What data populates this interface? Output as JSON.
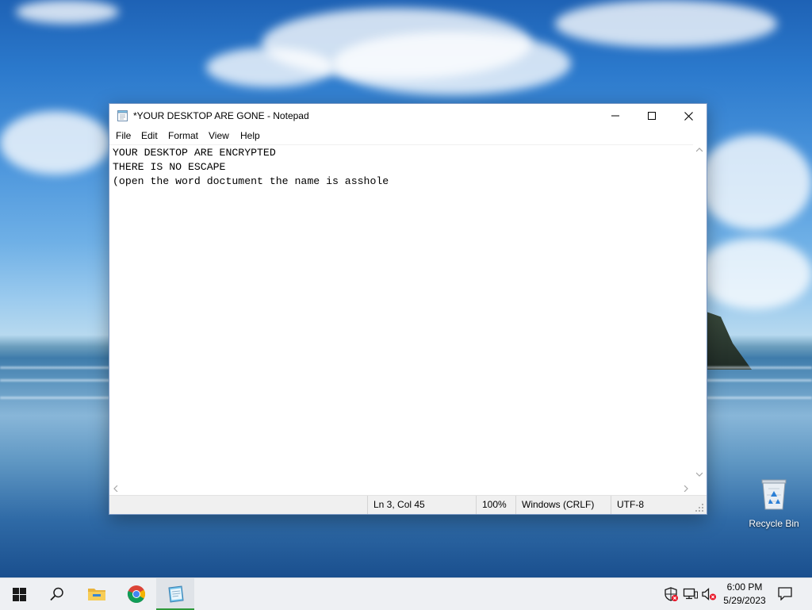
{
  "desktop": {
    "recycle_bin_label": "Recycle Bin"
  },
  "notepad": {
    "title": "*YOUR DESKTOP ARE GONE - Notepad",
    "menu": [
      "File",
      "Edit",
      "Format",
      "View",
      "Help"
    ],
    "content_lines": [
      "YOUR DESKTOP ARE ENCRYPTED",
      "THERE IS NO ESCAPE",
      "(open the word doctument the name is asshole"
    ],
    "status": {
      "position": "Ln 3, Col 45",
      "zoom": "100%",
      "line_ending": "Windows (CRLF)",
      "encoding": "UTF-8"
    }
  },
  "taskbar": {
    "pinned": [
      "start-icon",
      "search-icon",
      "file-explorer-icon",
      "chrome-icon",
      "notepad-icon"
    ],
    "active_app": "notepad",
    "clock": {
      "time": "6:00 PM",
      "date": "5/29/2023"
    },
    "tray_icons": [
      "security-warning-icon",
      "network-icon",
      "volume-muted-icon"
    ]
  },
  "colors": {
    "taskbar_bg": "#eef0f3",
    "active_indicator": "#2f9a3a",
    "window_border": "#7a98c4"
  }
}
